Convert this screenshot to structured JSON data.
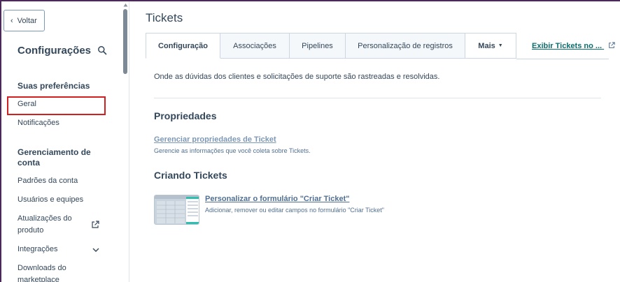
{
  "sidebar": {
    "back_label": "Voltar",
    "title": "Configurações",
    "section_preferences": "Suas preferências",
    "item_geral": "Geral",
    "item_notificacoes": "Notificações",
    "section_account_line1": "Gerenciamento de",
    "section_account_line2": "conta",
    "item_padroes": "Padrões da conta",
    "item_usuarios": "Usuários e equipes",
    "item_atualizacoes_line1": "Atualizações do",
    "item_atualizacoes_line2": "produto",
    "item_integracoes": "Integrações",
    "item_downloads_line1": "Downloads do",
    "item_downloads_line2": "marketplace"
  },
  "main": {
    "title": "Tickets",
    "tabs": [
      {
        "label": "Configuração"
      },
      {
        "label": "Associações"
      },
      {
        "label": "Pipelines"
      },
      {
        "label": "Personalização de registros"
      },
      {
        "label": "Mais"
      }
    ],
    "view_link": "Exibir Tickets no ...",
    "description": "Onde as dúvidas dos clientes e solicitações de suporte são rastreadas e resolvidas.",
    "properties_heading": "Propriedades",
    "properties_link": "Gerenciar propriedades de Ticket",
    "properties_desc": "Gerencie as informações que você coleta sobre Tickets.",
    "creating_heading": "Criando Tickets",
    "form_link": "Personalizar o formulário \"Criar Ticket\"",
    "form_desc": "Adicionar, remover ou editar campos no formulário \"Criar Ticket\""
  },
  "colors": {
    "text": "#33475b",
    "link": "#0b6e6e",
    "muted_link": "#7c98b6",
    "highlight": "#d21f1f",
    "frame": "#4b2a5a"
  }
}
